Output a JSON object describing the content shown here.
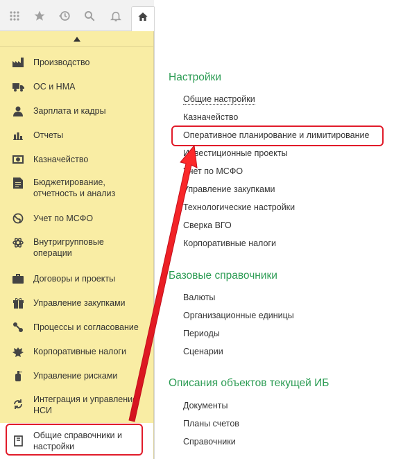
{
  "sidebar": {
    "items": [
      {
        "label": "Производство",
        "icon": "factory-icon"
      },
      {
        "label": "ОС и НМА",
        "icon": "truck-icon"
      },
      {
        "label": "Зарплата и кадры",
        "icon": "person-icon"
      },
      {
        "label": "Отчеты",
        "icon": "bar-chart-icon"
      },
      {
        "label": "Казначейство",
        "icon": "banknote-icon"
      },
      {
        "label": "Бюджетирование,\nотчетность и анализ",
        "icon": "budget-icon"
      },
      {
        "label": "Учет по МСФО",
        "icon": "globe-icon"
      },
      {
        "label": "Внутригрупповые\nоперации",
        "icon": "atom-icon"
      },
      {
        "label": "Договоры и проекты",
        "icon": "briefcase-icon"
      },
      {
        "label": "Управление закупками",
        "icon": "gift-icon"
      },
      {
        "label": "Процессы и согласование",
        "icon": "process-icon"
      },
      {
        "label": "Корпоративные налоги",
        "icon": "eagle-icon"
      },
      {
        "label": "Управление рисками",
        "icon": "fire-extinguisher-icon"
      },
      {
        "label": "Интеграция и управление\nНСИ",
        "icon": "sync-icon"
      },
      {
        "label": "Общие справочники и\nнастройки",
        "icon": "book-icon"
      }
    ]
  },
  "sections": [
    {
      "title": "Настройки",
      "links": [
        "Общие настройки",
        "Казначейство",
        "Оперативное планирование и лимитирование",
        "Инвестиционные проекты",
        "Учет по МСФО",
        "Управление закупками",
        "Технологические настройки",
        "Сверка ВГО",
        "Корпоративные налоги"
      ]
    },
    {
      "title": "Базовые справочники",
      "links": [
        "Валюты",
        "Организационные единицы",
        "Периоды",
        "Сценарии"
      ]
    },
    {
      "title": "Описания объектов текущей ИБ",
      "links": [
        "Документы",
        "Планы счетов",
        "Справочники"
      ]
    }
  ],
  "colors": {
    "sidebar_bg": "#f9eda4",
    "section_title": "#2c9c54",
    "highlight": "#e11b2a"
  }
}
